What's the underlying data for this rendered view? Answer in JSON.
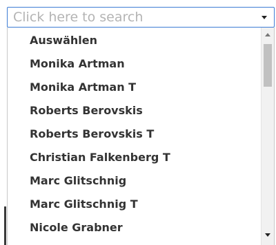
{
  "search": {
    "placeholder": "Click here to search",
    "value": ""
  },
  "options": [
    {
      "label": "Auswählen"
    },
    {
      "label": "Monika Artman"
    },
    {
      "label": "Monika Artman T"
    },
    {
      "label": "Roberts Berovskis"
    },
    {
      "label": "Roberts Berovskis T"
    },
    {
      "label": "Christian Falkenberg T"
    },
    {
      "label": "Marc Glitschnig"
    },
    {
      "label": "Marc Glitschnig T"
    },
    {
      "label": "Nicole Grabner"
    }
  ],
  "scrollbar": {
    "position_fraction": 0.0
  },
  "colors": {
    "focus_border": "#3b7bd4",
    "option_text": "#333333",
    "placeholder": "#b4b4b4"
  },
  "icons": {
    "dropdown": "chevron-down-icon",
    "scroll_up": "scroll-up-icon",
    "scroll_down": "scroll-down-icon"
  }
}
